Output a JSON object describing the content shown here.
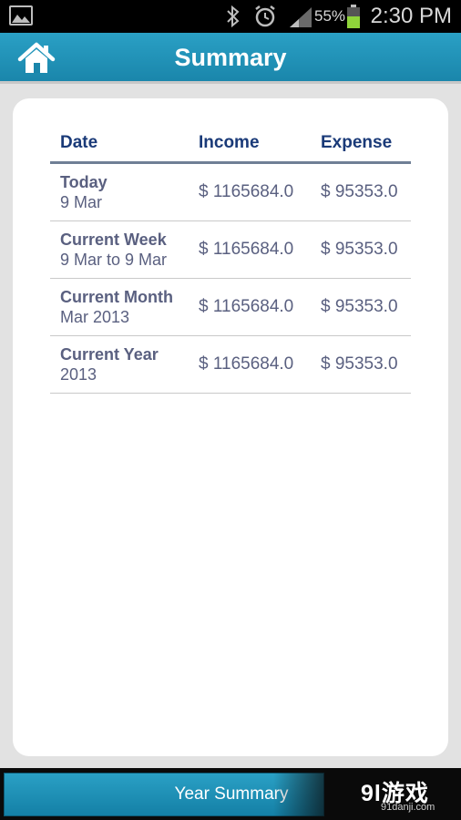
{
  "status_bar": {
    "battery_percent": "55%",
    "time": "2:30 PM"
  },
  "header": {
    "title": "Summary"
  },
  "table": {
    "columns": [
      "Date",
      "Income",
      "Expense"
    ],
    "rows": [
      {
        "label": "Today",
        "sub": "9 Mar",
        "income": "$ 1165684.0",
        "expense": "$ 95353.0"
      },
      {
        "label": "Current Week",
        "sub": "9 Mar to 9 Mar",
        "income": "$ 1165684.0",
        "expense": "$ 95353.0"
      },
      {
        "label": "Current Month",
        "sub": "Mar 2013",
        "income": "$ 1165684.0",
        "expense": "$ 95353.0"
      },
      {
        "label": "Current Year",
        "sub": "2013",
        "income": "$ 1165684.0",
        "expense": "$ 95353.0"
      }
    ]
  },
  "footer": {
    "year_summary_label": "Year Summary",
    "watermark": "9l游戏",
    "watermark_url": "91danji.com"
  },
  "colors": {
    "accent": "#1f93bb",
    "header_text": "#1a3a78",
    "body_text": "#5a6080"
  },
  "icons": {
    "home": "home-icon",
    "gallery": "image-icon",
    "bluetooth": "bluetooth-icon",
    "alarm": "alarm-icon",
    "signal": "signal-icon",
    "battery": "battery-icon"
  }
}
